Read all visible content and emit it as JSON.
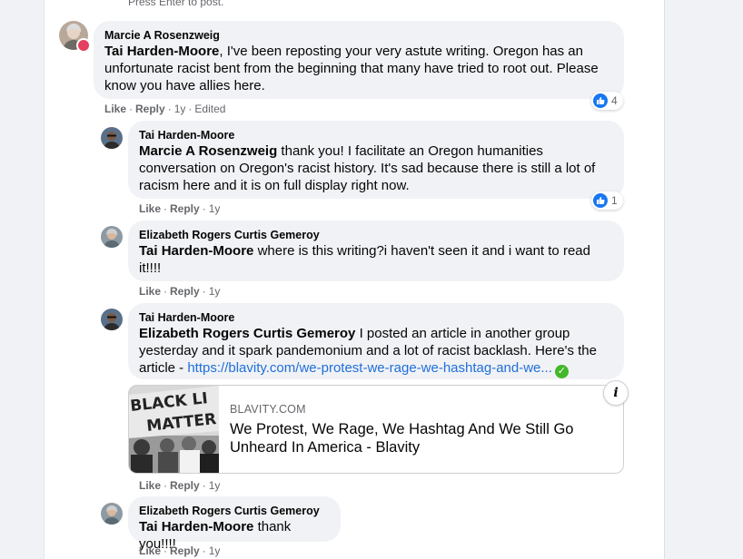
{
  "hint": "Press Enter to post.",
  "comments": [
    {
      "author": "Marcie A Rosenzweig",
      "mention": "Tai Harden-Moore",
      "body": ", I've been reposting your very astute writing. Oregon has an unfortunate racist bent from the beginning that many have tried to root out. Please know you have allies here.",
      "actions": {
        "like": "Like",
        "reply": "Reply",
        "age": "1y",
        "edited": "Edited"
      },
      "reaction_count": "4"
    },
    {
      "author": "Tai Harden-Moore",
      "mention": "Marcie A Rosenzweig",
      "body": " thank you! I facilitate an Oregon humanities conversation on Oregon's racist history. It's sad because there is still a lot of racism here and it is on full display right now.",
      "actions": {
        "like": "Like",
        "reply": "Reply",
        "age": "1y"
      },
      "reaction_count": "1"
    },
    {
      "author": "Elizabeth Rogers Curtis Gemeroy",
      "mention": "Tai Harden-Moore",
      "body": " where is this writing?i haven't seen it and i want to read it!!!!",
      "actions": {
        "like": "Like",
        "reply": "Reply",
        "age": "1y"
      }
    },
    {
      "author": "Tai Harden-Moore",
      "mention": "Elizabeth Rogers Curtis Gemeroy",
      "body": " I posted an article in another group yesterday and it spark pandemonium and a lot of racist backlash. Here's the article - ",
      "link": "https://blavity.com/we-protest-we-rage-we-hashtag-and-we...",
      "actions": {
        "like": "Like",
        "reply": "Reply",
        "age": "1y"
      },
      "card": {
        "domain": "BLAVITY.COM",
        "title": "We Protest, We Rage, We Hashtag And We Still Go Unheard In America - Blavity",
        "info_icon": "info-icon",
        "info_glyph": "i"
      }
    },
    {
      "author": "Elizabeth Rogers Curtis Gemeroy",
      "mention": "Tai Harden-Moore",
      "body": " thank you!!!!",
      "actions": {
        "like": "Like",
        "reply": "Reply",
        "age": "1y"
      }
    }
  ],
  "separator": "·",
  "colors": {
    "like_blue": "#1877f2",
    "link_blue": "#216fdb",
    "bubble_gray": "#f0f2f5",
    "muted": "#65676b"
  }
}
